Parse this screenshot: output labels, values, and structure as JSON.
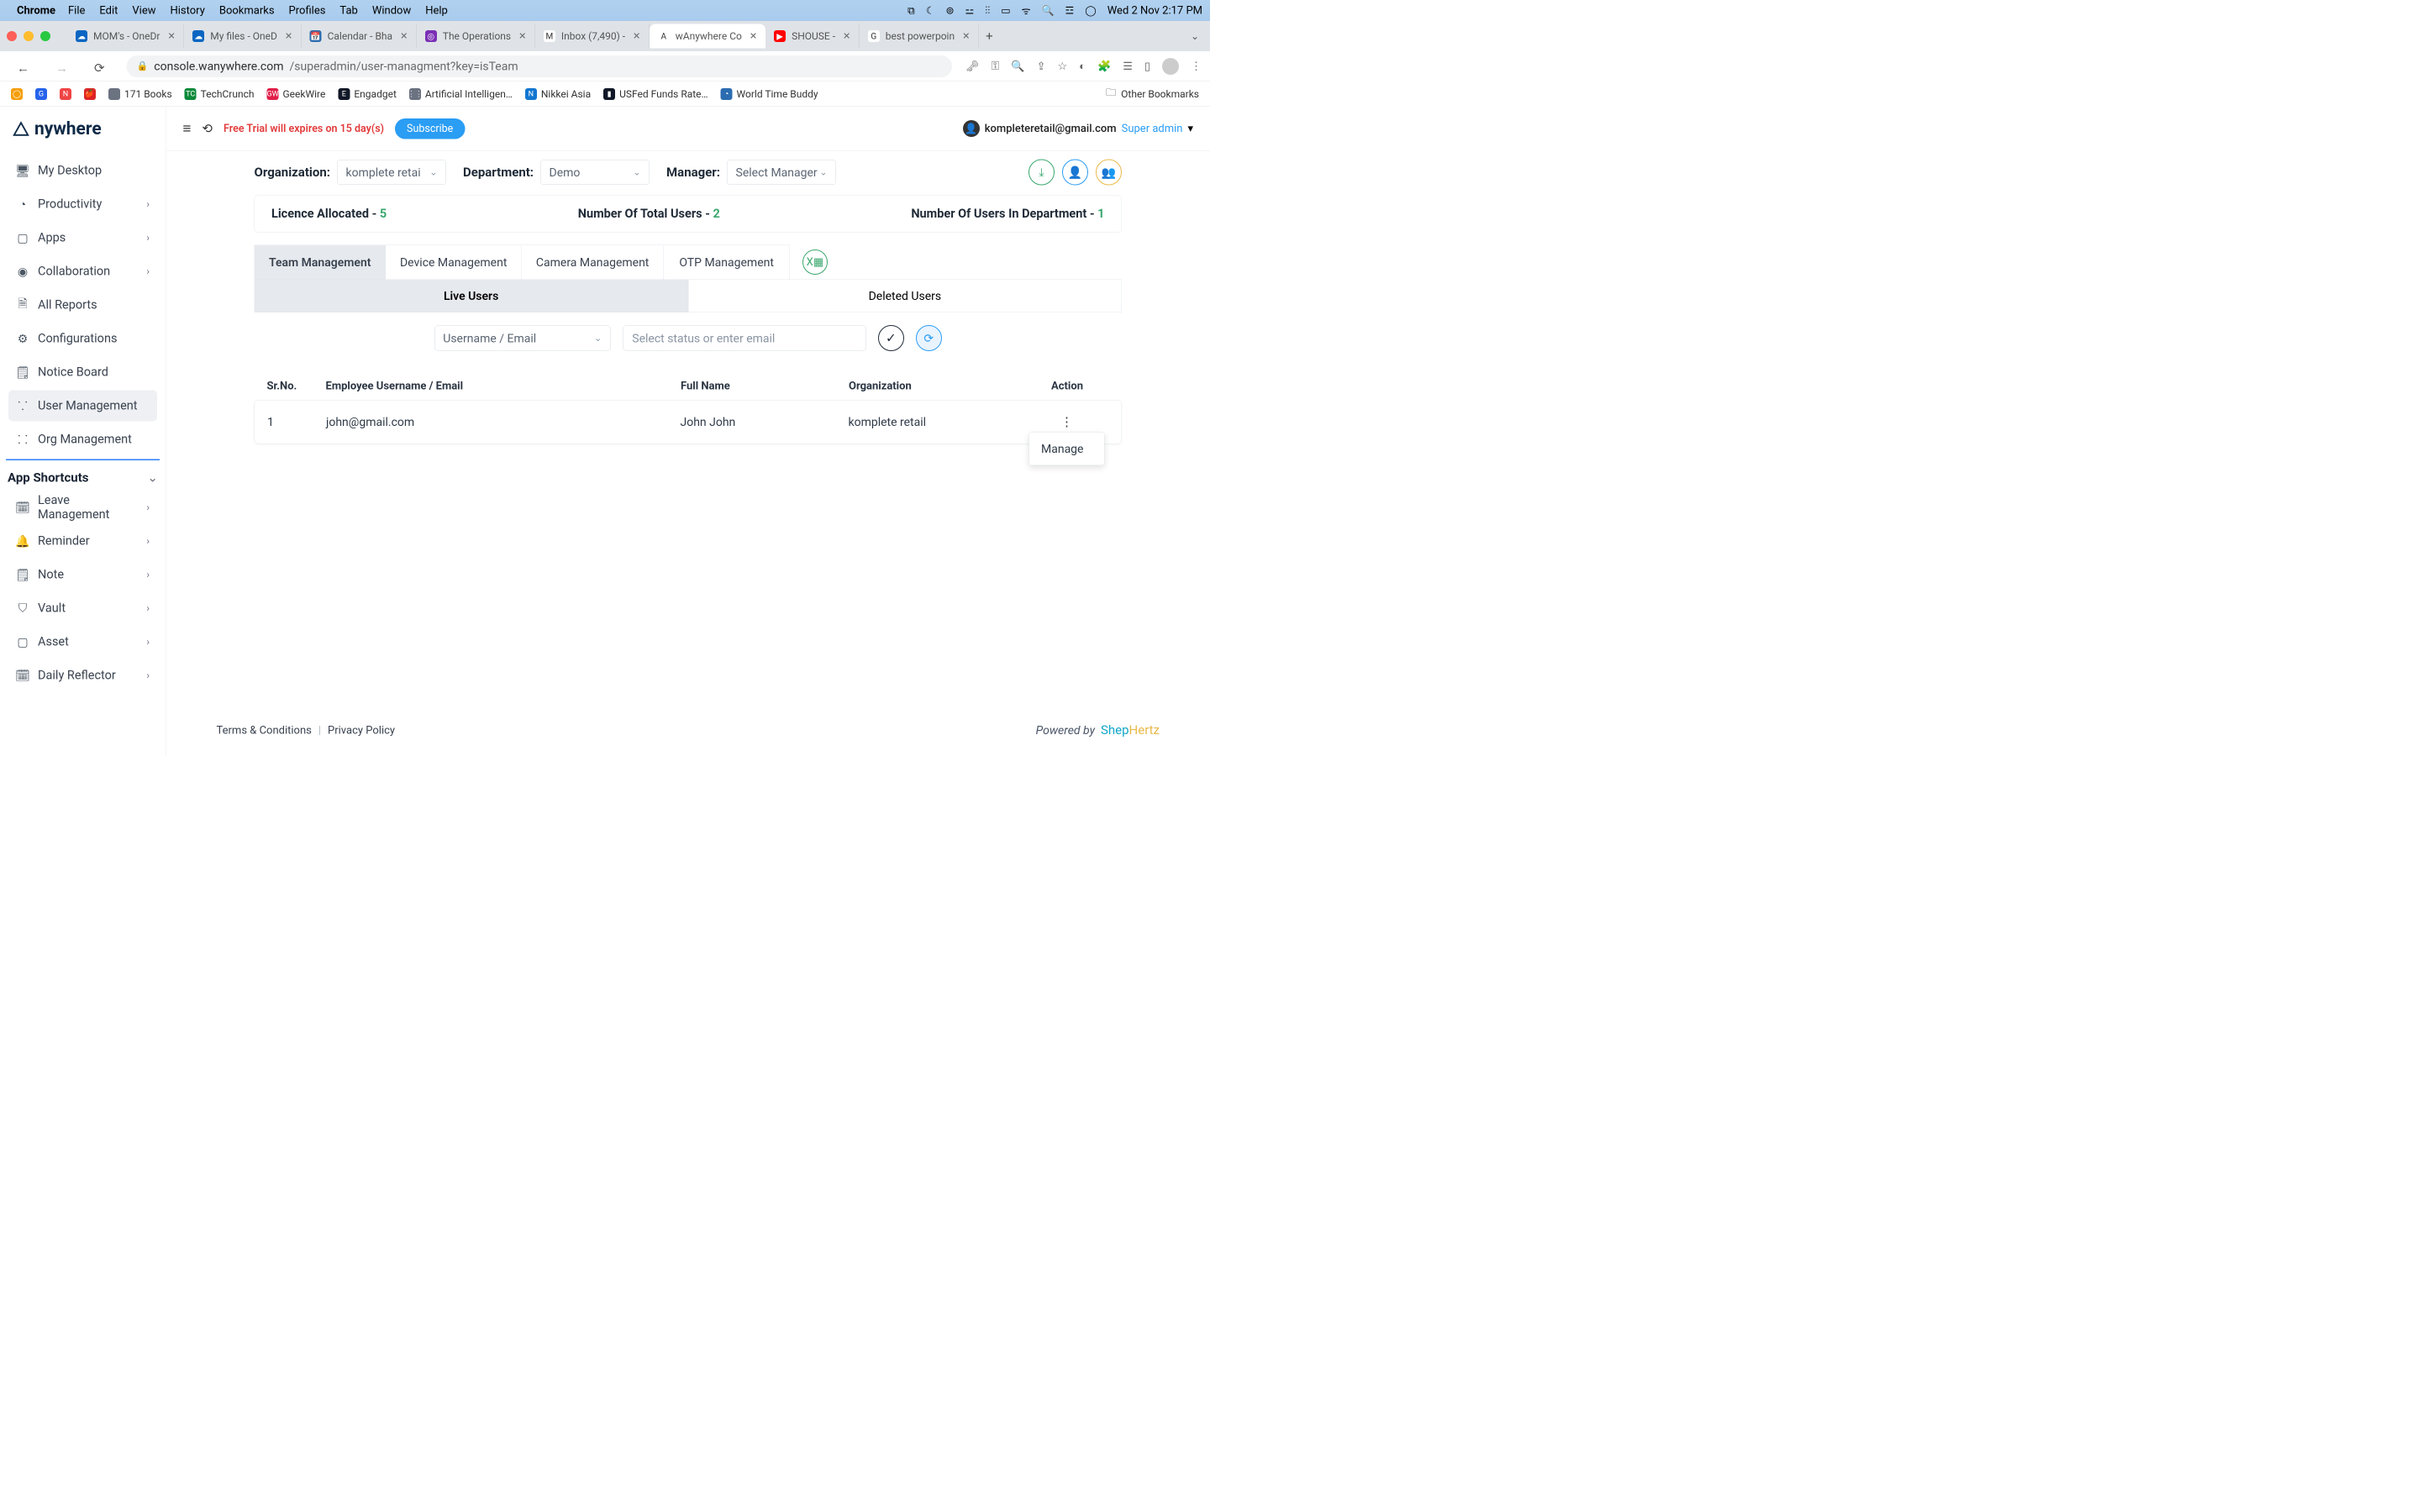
{
  "menubar": {
    "app": "Chrome",
    "items": [
      "File",
      "Edit",
      "View",
      "History",
      "Bookmarks",
      "Profiles",
      "Tab",
      "Window",
      "Help"
    ],
    "clock": "Wed 2 Nov  2:17 PM"
  },
  "tabs": [
    {
      "label": "MOM's - OneDr",
      "favbg": "#0a66c2",
      "favtxt": "☁"
    },
    {
      "label": "My files - OneD",
      "favbg": "#0a66c2",
      "favtxt": "☁"
    },
    {
      "label": "Calendar - Bha",
      "favbg": "#2b6cb0",
      "favtxt": "📅"
    },
    {
      "label": "The Operations",
      "favbg": "#7b2fb5",
      "favtxt": "◎"
    },
    {
      "label": "Inbox (7,490) -",
      "favbg": "#fff",
      "favtxt": "M"
    },
    {
      "label": "wAnywhere Co",
      "favbg": "#fff",
      "favtxt": "A",
      "active": true
    },
    {
      "label": "SHOUSE - ",
      "favbg": "#ff0000",
      "favtxt": "▶"
    },
    {
      "label": "best powerpoin",
      "favbg": "#fff",
      "favtxt": "G"
    }
  ],
  "url": {
    "host": "console.wanywhere.com",
    "path": "/superadmin/user-managment?key=isTeam"
  },
  "bookmarks": [
    {
      "label": "",
      "bg": "#f59e0b",
      "txt": "◯"
    },
    {
      "label": "",
      "bg": "#2563eb",
      "txt": "G"
    },
    {
      "label": "",
      "bg": "#ef4444",
      "txt": "N"
    },
    {
      "label": "",
      "bg": "#dc2626",
      "txt": "🍎"
    },
    {
      "label": "171 Books",
      "bg": "#6b7280",
      "txt": ""
    },
    {
      "label": "TechCrunch",
      "bg": "#0a8a3a",
      "txt": "TC"
    },
    {
      "label": "GeekWire",
      "bg": "#e11d48",
      "txt": "GW"
    },
    {
      "label": "Engadget",
      "bg": "#111827",
      "txt": "E"
    },
    {
      "label": "Artificial Intelligen…",
      "bg": "#6b7280",
      "txt": "⋮⋮"
    },
    {
      "label": "Nikkei Asia",
      "bg": "#1276d1",
      "txt": "N"
    },
    {
      "label": "USFed Funds Rate…",
      "bg": "#111827",
      "txt": "▮"
    },
    {
      "label": "World Time Buddy",
      "bg": "#2b6cb0",
      "txt": "◔"
    }
  ],
  "other_bookmarks": "Other Bookmarks",
  "logo": "nywhere",
  "sidebar_nav": [
    {
      "icon": "🖥",
      "label": "My Desktop"
    },
    {
      "icon": "◔",
      "label": "Productivity",
      "chev": true
    },
    {
      "icon": "▢",
      "label": "Apps",
      "chev": true
    },
    {
      "icon": "◉",
      "label": "Collaboration",
      "chev": true
    },
    {
      "icon": "🗎",
      "label": "All Reports"
    },
    {
      "icon": "⚙",
      "label": "Configurations"
    },
    {
      "icon": "🗒",
      "label": "Notice Board"
    },
    {
      "icon": "⸪",
      "label": "User Management",
      "active": true
    },
    {
      "icon": "⸬",
      "label": "Org Management"
    }
  ],
  "sidebar_section": "App Shortcuts",
  "sidebar_shortcuts": [
    {
      "icon": "🗓",
      "label": "Leave Management",
      "chev": true
    },
    {
      "icon": "🔔",
      "label": "Reminder",
      "chev": true
    },
    {
      "icon": "🗒",
      "label": "Note",
      "chev": true
    },
    {
      "icon": "⛉",
      "label": "Vault",
      "chev": true
    },
    {
      "icon": "▢",
      "label": "Asset",
      "chev": true
    },
    {
      "icon": "🗓",
      "label": "Daily Reflector",
      "chev": true
    }
  ],
  "topbar": {
    "trial": "Free Trial will expires on 15 day(s)",
    "subscribe": "Subscribe",
    "email": "kompleteretail@gmail.com",
    "role": "Super admin"
  },
  "filters": {
    "org_label": "Organization:",
    "org_value": "komplete retai",
    "dept_label": "Department:",
    "dept_value": "Demo",
    "mgr_label": "Manager:",
    "mgr_value": "Select Manager"
  },
  "stats": {
    "s1_label": "Licence Allocated - ",
    "s1_val": "5",
    "s2_label": "Number Of Total Users - ",
    "s2_val": "2",
    "s3_label": "Number Of Users In Department - ",
    "s3_val": "1"
  },
  "mgmt_tabs": [
    "Team Management",
    "Device Management",
    "Camera Management",
    "OTP Management"
  ],
  "subtabs": [
    "Live Users",
    "Deleted Users"
  ],
  "search": {
    "type": "Username / Email",
    "placeholder": "Select status or enter email"
  },
  "table": {
    "headers": [
      "Sr.No.",
      "Employee Username / Email",
      "Full Name",
      "Organization",
      "Action"
    ],
    "rows": [
      {
        "sr": "1",
        "email": "john@gmail.com",
        "name": "John John",
        "org": "komplete retail"
      }
    ]
  },
  "popover_item": "Manage",
  "footer": {
    "terms": "Terms & Conditions",
    "privacy": "Privacy Policy",
    "powered": "Powered by",
    "brand1": "Shep",
    "brand2": "Hertz"
  }
}
